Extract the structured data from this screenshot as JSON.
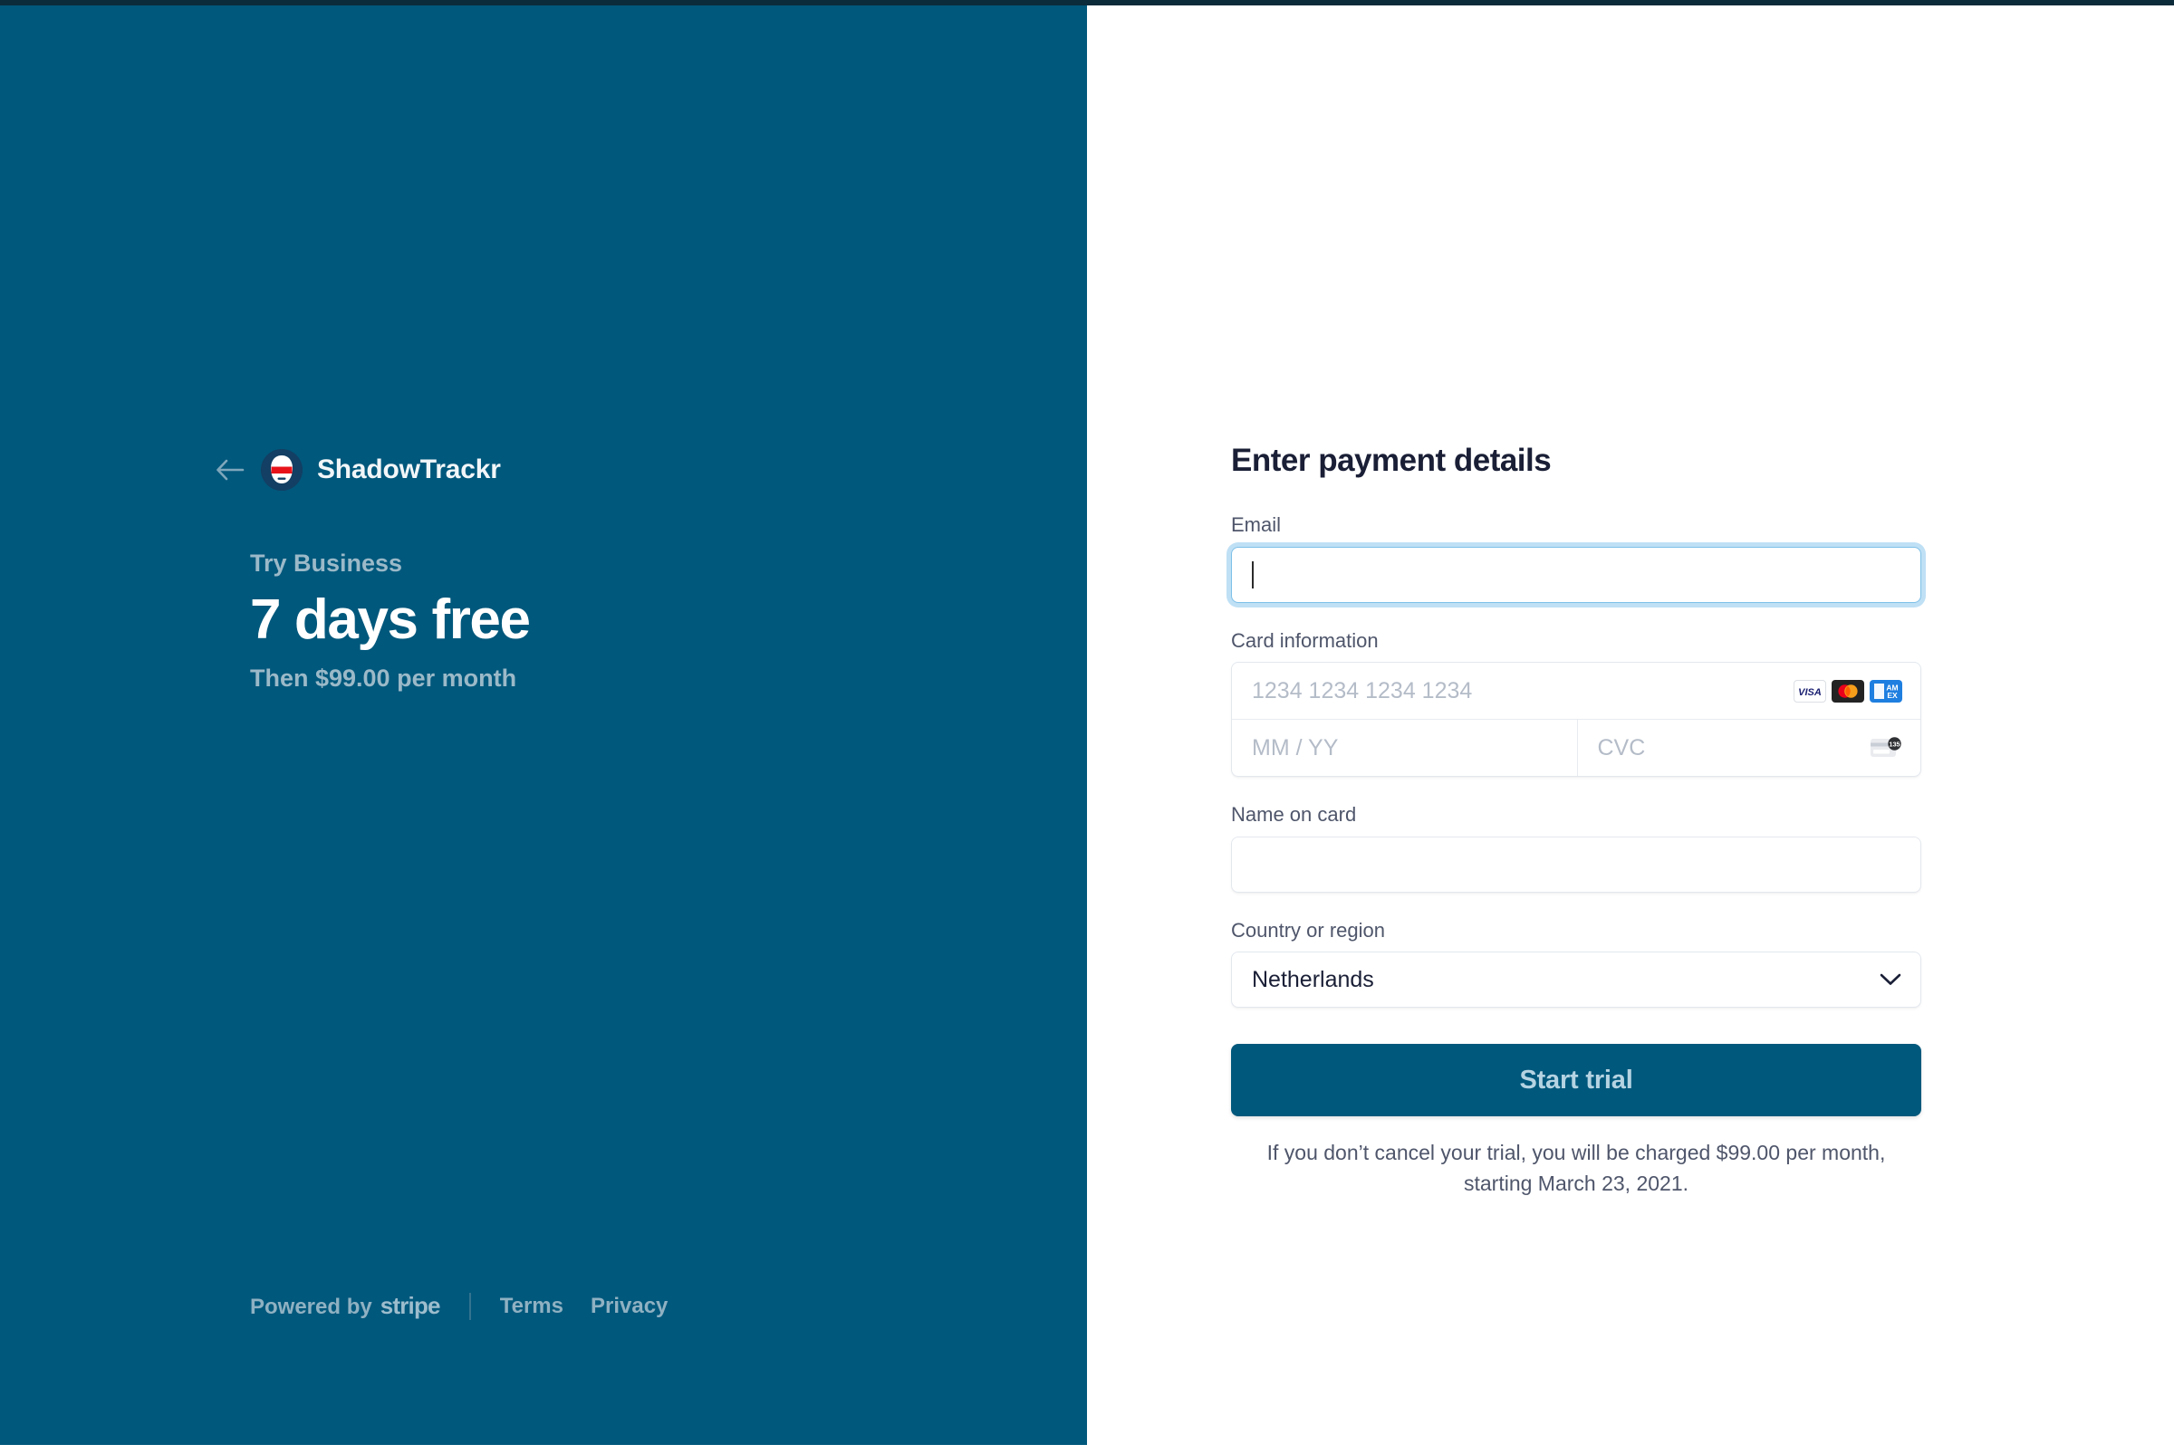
{
  "left": {
    "back_icon": "back-arrow-icon",
    "logo_icon": "shadowtrackr-logo-icon",
    "brand_name": "ShadowTrackr",
    "trial_eyebrow": "Try Business",
    "trial_headline": "7 days free",
    "trial_subtext": "Then $99.00 per month",
    "footer": {
      "powered_by_prefix": "Powered by",
      "powered_by_brand": "stripe",
      "terms_label": "Terms",
      "privacy_label": "Privacy"
    }
  },
  "right": {
    "title": "Enter payment details",
    "email": {
      "label": "Email",
      "value": "",
      "placeholder": "",
      "focused": true
    },
    "card": {
      "label": "Card information",
      "number_placeholder": "1234 1234 1234 1234",
      "number_value": "",
      "expiry_placeholder": "MM / YY",
      "expiry_value": "",
      "cvc_placeholder": "CVC",
      "cvc_value": "",
      "cvc_icon": "cvc-card-icon",
      "cvc_icon_digits": "135",
      "brands": [
        {
          "name": "visa-icon",
          "label": "VISA"
        },
        {
          "name": "mastercard-icon",
          "label": "mastercard"
        },
        {
          "name": "amex-icon",
          "label": "AMEX"
        }
      ]
    },
    "name_on_card": {
      "label": "Name on card",
      "value": "",
      "placeholder": ""
    },
    "country": {
      "label": "Country or region",
      "selected": "Netherlands",
      "chevron_icon": "chevron-down-icon"
    },
    "submit_label": "Start trial",
    "disclaimer": "If you don’t cancel your trial, you will be charged $99.00 per month, starting March 23, 2021."
  },
  "colors": {
    "brand_blue": "#00587c",
    "muted_on_blue": "#9bb9c8",
    "focus_ring": "#bfe0f5",
    "border_grey": "#e3e8ee",
    "placeholder_grey": "#b4bcc8",
    "label_grey": "#4f566b",
    "title_dark": "#1a1f36",
    "button_text": "#b5d3e2"
  }
}
